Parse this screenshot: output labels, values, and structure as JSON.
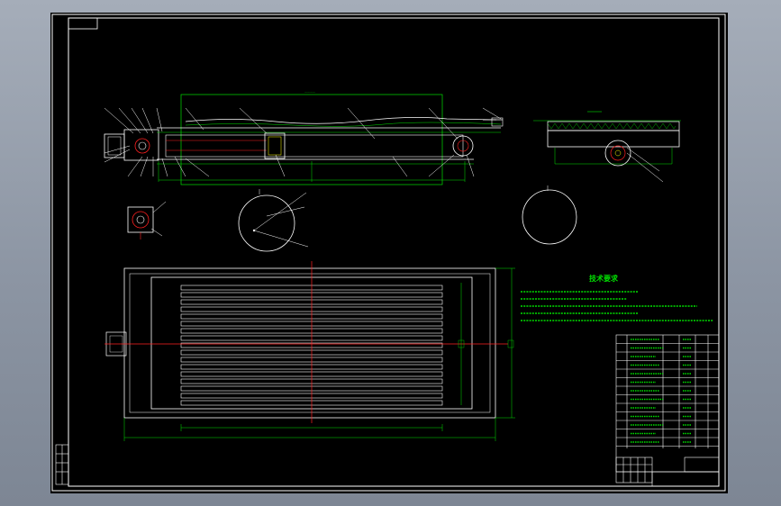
{
  "drawing": {
    "line_color": "#00e000",
    "outline_color": "#ffffff",
    "center_color": "#ff2020",
    "accent_color": "#ffff00",
    "background": "#000000",
    "frame_color": "#ffffff"
  },
  "notes": {
    "title": "技术要求"
  }
}
